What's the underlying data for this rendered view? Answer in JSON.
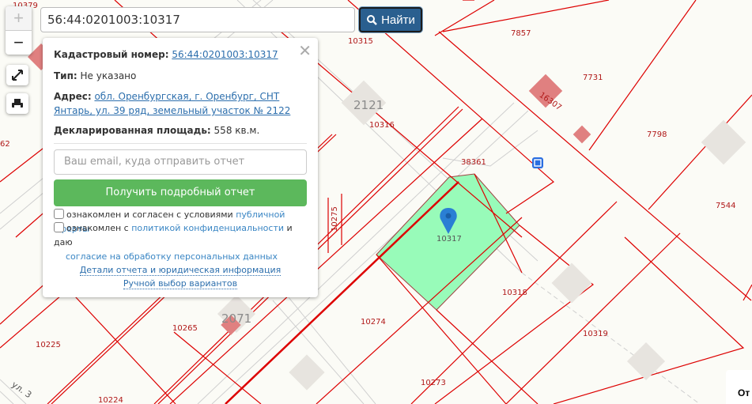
{
  "search": {
    "value": "56:44:0201003:10317",
    "button_label": "Найти"
  },
  "controls": {
    "zoom_in": "+",
    "zoom_out": "−"
  },
  "popup": {
    "cadastral_label": "Кадастровый номер:",
    "cadastral_value": "56:44:0201003:10317",
    "type_label": "Тип:",
    "type_value": "Не указано",
    "address_label": "Адрес:",
    "address_value": "обл. Оренбургская, г. Оренбург, СНТ Янтарь, ул. 39 ряд, земельный участок № 2122",
    "area_label": "Декларированная площадь:",
    "area_value": "558 кв.м.",
    "email_placeholder": "Ваш email, куда отправить отчет",
    "get_report": "Получить подробный отчет",
    "agree1_text": "ознакомлен и согласен с условиями",
    "agree1_link": "публичной оферты",
    "agree2_text": "ознакомлен с",
    "agree2_link": "политикой конфиденциальности",
    "agree2_mid": "и даю",
    "agree2_link2": "согласие на обработку персональных данных",
    "details_link": "Детали отчета и юридическая информация",
    "manual_link": "Ручной выбор вариантов"
  },
  "map": {
    "parcels": [
      "10379",
      "10315",
      "7857",
      "7731",
      "10316",
      "16307",
      "7798",
      "38361",
      "10317",
      "7544",
      "10275",
      "10318",
      "10274",
      "10319",
      "10265",
      "10225",
      "10273",
      "10224",
      "62"
    ],
    "buildings": [
      "2121",
      "2071"
    ],
    "street": "ул. 3",
    "selected_color": "#98fbb9",
    "border_color": "#dd0000"
  },
  "corner_panel": "От"
}
